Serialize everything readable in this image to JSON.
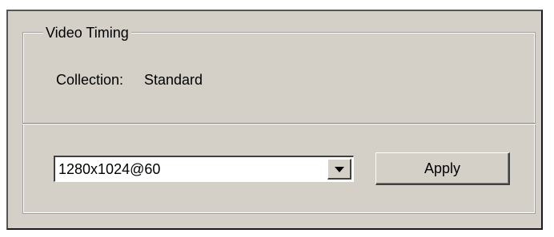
{
  "group": {
    "title": "Video Timing"
  },
  "collection": {
    "label": "Collection:",
    "value": "Standard"
  },
  "timing_select": {
    "selected": "1280x1024@60",
    "dropdown_icon": "chevron-down-icon"
  },
  "actions": {
    "apply_label": "Apply"
  },
  "colors": {
    "background": "#ffffff",
    "panel": "#d4d0c8",
    "text": "#000000",
    "shadow": "#808080",
    "highlight": "#ffffff"
  }
}
